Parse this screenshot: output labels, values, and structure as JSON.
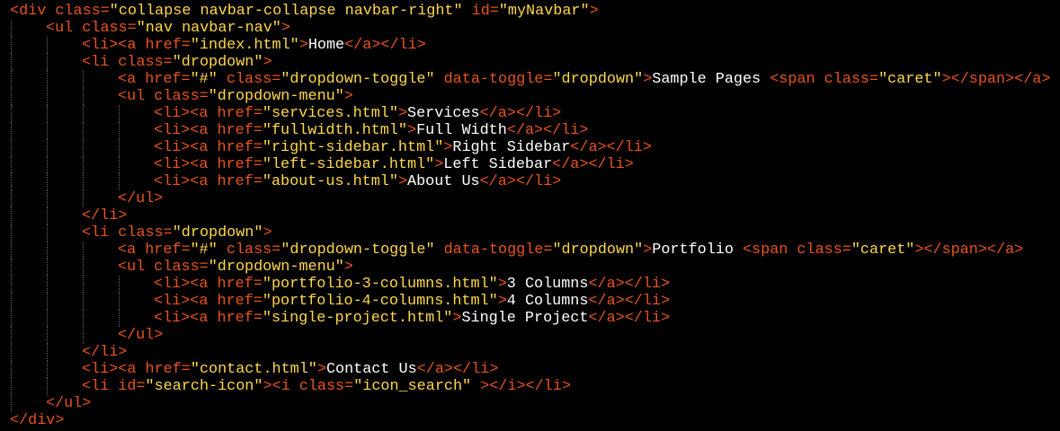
{
  "editor": {
    "lines": [
      {
        "indent": 0,
        "segments": [
          {
            "t": "tag",
            "s": "<div "
          },
          {
            "t": "attr",
            "s": "class"
          },
          {
            "t": "eq",
            "s": "="
          },
          {
            "t": "val",
            "s": "\"collapse navbar-collapse navbar-right\""
          },
          {
            "t": "attr",
            "s": " id"
          },
          {
            "t": "eq",
            "s": "="
          },
          {
            "t": "val",
            "s": "\"myNavbar\""
          },
          {
            "t": "tag",
            "s": ">"
          }
        ]
      },
      {
        "indent": 1,
        "segments": [
          {
            "t": "tag",
            "s": "<ul "
          },
          {
            "t": "attr",
            "s": "class"
          },
          {
            "t": "eq",
            "s": "="
          },
          {
            "t": "val",
            "s": "\"nav navbar-nav\""
          },
          {
            "t": "tag",
            "s": ">"
          }
        ]
      },
      {
        "indent": 2,
        "segments": [
          {
            "t": "tag",
            "s": "<li><a "
          },
          {
            "t": "attr",
            "s": "href"
          },
          {
            "t": "eq",
            "s": "="
          },
          {
            "t": "val",
            "s": "\"index.html\""
          },
          {
            "t": "tag",
            "s": ">"
          },
          {
            "t": "txt",
            "s": "Home"
          },
          {
            "t": "tag",
            "s": "</a></li>"
          }
        ]
      },
      {
        "indent": 2,
        "segments": [
          {
            "t": "tag",
            "s": "<li "
          },
          {
            "t": "attr",
            "s": "class"
          },
          {
            "t": "eq",
            "s": "="
          },
          {
            "t": "val",
            "s": "\"dropdown\""
          },
          {
            "t": "tag",
            "s": ">"
          }
        ]
      },
      {
        "indent": 3,
        "segments": [
          {
            "t": "tag",
            "s": "<a "
          },
          {
            "t": "attr",
            "s": "href"
          },
          {
            "t": "eq",
            "s": "="
          },
          {
            "t": "val",
            "s": "\"#\""
          },
          {
            "t": "attr",
            "s": " class"
          },
          {
            "t": "eq",
            "s": "="
          },
          {
            "t": "val",
            "s": "\"dropdown-toggle\""
          },
          {
            "t": "attr",
            "s": " data-toggle"
          },
          {
            "t": "eq",
            "s": "="
          },
          {
            "t": "val",
            "s": "\"dropdown\""
          },
          {
            "t": "tag",
            "s": ">"
          },
          {
            "t": "txt",
            "s": "Sample Pages "
          },
          {
            "t": "tag",
            "s": "<span "
          },
          {
            "t": "attr",
            "s": "class"
          },
          {
            "t": "eq",
            "s": "="
          },
          {
            "t": "val",
            "s": "\"caret\""
          },
          {
            "t": "tag",
            "s": "></span></a>"
          }
        ]
      },
      {
        "indent": 3,
        "segments": [
          {
            "t": "tag",
            "s": "<ul "
          },
          {
            "t": "attr",
            "s": "class"
          },
          {
            "t": "eq",
            "s": "="
          },
          {
            "t": "val",
            "s": "\"dropdown-menu\""
          },
          {
            "t": "tag",
            "s": ">"
          }
        ]
      },
      {
        "indent": 4,
        "segments": [
          {
            "t": "tag",
            "s": "<li><a "
          },
          {
            "t": "attr",
            "s": "href"
          },
          {
            "t": "eq",
            "s": "="
          },
          {
            "t": "val",
            "s": "\"services.html\""
          },
          {
            "t": "tag",
            "s": ">"
          },
          {
            "t": "txt",
            "s": "Services"
          },
          {
            "t": "tag",
            "s": "</a></li>"
          }
        ]
      },
      {
        "indent": 4,
        "segments": [
          {
            "t": "tag",
            "s": "<li><a "
          },
          {
            "t": "attr",
            "s": "href"
          },
          {
            "t": "eq",
            "s": "="
          },
          {
            "t": "val",
            "s": "\"fullwidth.html\""
          },
          {
            "t": "tag",
            "s": ">"
          },
          {
            "t": "txt",
            "s": "Full Width"
          },
          {
            "t": "tag",
            "s": "</a></li>"
          }
        ]
      },
      {
        "indent": 4,
        "segments": [
          {
            "t": "tag",
            "s": "<li><a "
          },
          {
            "t": "attr",
            "s": "href"
          },
          {
            "t": "eq",
            "s": "="
          },
          {
            "t": "val",
            "s": "\"right-sidebar.html\""
          },
          {
            "t": "tag",
            "s": ">"
          },
          {
            "t": "txt",
            "s": "Right Sidebar"
          },
          {
            "t": "tag",
            "s": "</a></li>"
          }
        ]
      },
      {
        "indent": 4,
        "segments": [
          {
            "t": "tag",
            "s": "<li><a "
          },
          {
            "t": "attr",
            "s": "href"
          },
          {
            "t": "eq",
            "s": "="
          },
          {
            "t": "val",
            "s": "\"left-sidebar.html\""
          },
          {
            "t": "tag",
            "s": ">"
          },
          {
            "t": "txt",
            "s": "Left Sidebar"
          },
          {
            "t": "tag",
            "s": "</a></li>"
          }
        ]
      },
      {
        "indent": 4,
        "segments": [
          {
            "t": "tag",
            "s": "<li><a "
          },
          {
            "t": "attr",
            "s": "href"
          },
          {
            "t": "eq",
            "s": "="
          },
          {
            "t": "val",
            "s": "\"about-us.html\""
          },
          {
            "t": "tag",
            "s": ">"
          },
          {
            "t": "txt",
            "s": "About Us"
          },
          {
            "t": "tag",
            "s": "</a></li>"
          }
        ]
      },
      {
        "indent": 3,
        "segments": [
          {
            "t": "tag",
            "s": "</ul>"
          }
        ]
      },
      {
        "indent": 2,
        "segments": [
          {
            "t": "tag",
            "s": "</li>"
          }
        ]
      },
      {
        "indent": 2,
        "segments": [
          {
            "t": "tag",
            "s": "<li "
          },
          {
            "t": "attr",
            "s": "class"
          },
          {
            "t": "eq",
            "s": "="
          },
          {
            "t": "val",
            "s": "\"dropdown\""
          },
          {
            "t": "tag",
            "s": ">"
          }
        ]
      },
      {
        "indent": 3,
        "segments": [
          {
            "t": "tag",
            "s": "<a "
          },
          {
            "t": "attr",
            "s": "href"
          },
          {
            "t": "eq",
            "s": "="
          },
          {
            "t": "val",
            "s": "\"#\""
          },
          {
            "t": "attr",
            "s": " class"
          },
          {
            "t": "eq",
            "s": "="
          },
          {
            "t": "val",
            "s": "\"dropdown-toggle\""
          },
          {
            "t": "attr",
            "s": " data-toggle"
          },
          {
            "t": "eq",
            "s": "="
          },
          {
            "t": "val",
            "s": "\"dropdown\""
          },
          {
            "t": "tag",
            "s": ">"
          },
          {
            "t": "txt",
            "s": "Portfolio "
          },
          {
            "t": "tag",
            "s": "<span "
          },
          {
            "t": "attr",
            "s": "class"
          },
          {
            "t": "eq",
            "s": "="
          },
          {
            "t": "val",
            "s": "\"caret\""
          },
          {
            "t": "tag",
            "s": "></span></a>"
          }
        ]
      },
      {
        "indent": 3,
        "segments": [
          {
            "t": "tag",
            "s": "<ul "
          },
          {
            "t": "attr",
            "s": "class"
          },
          {
            "t": "eq",
            "s": "="
          },
          {
            "t": "val",
            "s": "\"dropdown-menu\""
          },
          {
            "t": "tag",
            "s": ">"
          }
        ]
      },
      {
        "indent": 4,
        "segments": [
          {
            "t": "tag",
            "s": "<li><a "
          },
          {
            "t": "attr",
            "s": "href"
          },
          {
            "t": "eq",
            "s": "="
          },
          {
            "t": "val",
            "s": "\"portfolio-3-columns.html\""
          },
          {
            "t": "tag",
            "s": ">"
          },
          {
            "t": "txt",
            "s": "3 Columns"
          },
          {
            "t": "tag",
            "s": "</a></li>"
          }
        ]
      },
      {
        "indent": 4,
        "segments": [
          {
            "t": "tag",
            "s": "<li><a "
          },
          {
            "t": "attr",
            "s": "href"
          },
          {
            "t": "eq",
            "s": "="
          },
          {
            "t": "val",
            "s": "\"portfolio-4-columns.html\""
          },
          {
            "t": "tag",
            "s": ">"
          },
          {
            "t": "txt",
            "s": "4 Columns"
          },
          {
            "t": "tag",
            "s": "</a></li>"
          }
        ]
      },
      {
        "indent": 4,
        "segments": [
          {
            "t": "tag",
            "s": "<li><a "
          },
          {
            "t": "attr",
            "s": "href"
          },
          {
            "t": "eq",
            "s": "="
          },
          {
            "t": "val",
            "s": "\"single-project.html\""
          },
          {
            "t": "tag",
            "s": ">"
          },
          {
            "t": "txt",
            "s": "Single Project"
          },
          {
            "t": "tag",
            "s": "</a></li>"
          }
        ]
      },
      {
        "indent": 3,
        "segments": [
          {
            "t": "tag",
            "s": "</ul>"
          }
        ]
      },
      {
        "indent": 2,
        "segments": [
          {
            "t": "tag",
            "s": "</li>"
          }
        ]
      },
      {
        "indent": 2,
        "segments": [
          {
            "t": "tag",
            "s": "<li><a "
          },
          {
            "t": "attr",
            "s": "href"
          },
          {
            "t": "eq",
            "s": "="
          },
          {
            "t": "val",
            "s": "\"contact.html\""
          },
          {
            "t": "tag",
            "s": ">"
          },
          {
            "t": "txt",
            "s": "Contact Us"
          },
          {
            "t": "tag",
            "s": "</a></li>"
          }
        ]
      },
      {
        "indent": 2,
        "segments": [
          {
            "t": "tag",
            "s": "<li "
          },
          {
            "t": "attr",
            "s": "id"
          },
          {
            "t": "eq",
            "s": "="
          },
          {
            "t": "val",
            "s": "\"search-icon\""
          },
          {
            "t": "tag",
            "s": "><i "
          },
          {
            "t": "attr",
            "s": "class"
          },
          {
            "t": "eq",
            "s": "="
          },
          {
            "t": "val",
            "s": "\"icon_search\""
          },
          {
            "t": "tag",
            "s": " ></i></li>"
          }
        ]
      },
      {
        "indent": 1,
        "segments": [
          {
            "t": "tag",
            "s": "</ul>"
          }
        ]
      },
      {
        "indent": 0,
        "segments": [
          {
            "t": "tag",
            "s": "</div>"
          }
        ]
      }
    ],
    "colors": {
      "background": "#000000",
      "tag": "#e8541c",
      "attribute_value": "#ffd84a",
      "text": "#ffffff",
      "indent_guide": "#6a6a6a"
    }
  }
}
